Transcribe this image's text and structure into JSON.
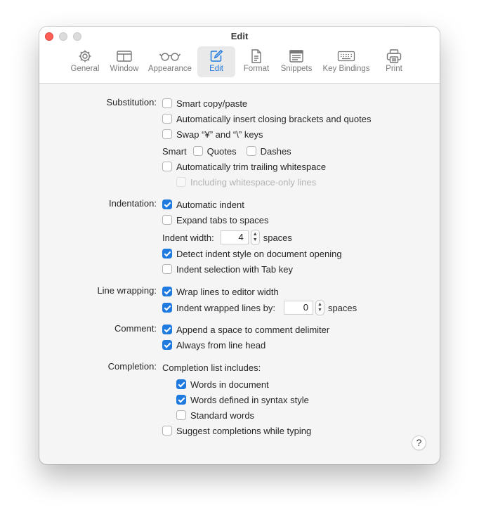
{
  "window": {
    "title": "Edit"
  },
  "toolbar": {
    "tabs": [
      {
        "label": "General",
        "icon": "gear-icon"
      },
      {
        "label": "Window",
        "icon": "window-layout-icon"
      },
      {
        "label": "Appearance",
        "icon": "glasses-icon"
      },
      {
        "label": "Edit",
        "icon": "pencil-square-icon",
        "selected": true
      },
      {
        "label": "Format",
        "icon": "document-icon"
      },
      {
        "label": "Snippets",
        "icon": "snippets-icon"
      },
      {
        "label": "Key Bindings",
        "icon": "keyboard-icon"
      },
      {
        "label": "Print",
        "icon": "printer-icon"
      }
    ]
  },
  "substitution": {
    "label": "Substitution:",
    "smart_copy_paste": {
      "label": "Smart copy/paste",
      "checked": false
    },
    "auto_closing": {
      "label": "Automatically insert closing brackets and quotes",
      "checked": false
    },
    "swap_keys": {
      "label": "Swap “¥” and “\\” keys",
      "checked": false
    },
    "smart_label": "Smart",
    "smart_quotes": {
      "label": "Quotes",
      "checked": false
    },
    "smart_dashes": {
      "label": "Dashes",
      "checked": false
    },
    "trim_whitespace": {
      "label": "Automatically trim trailing whitespace",
      "checked": false
    },
    "including_whitespace_only": {
      "label": "Including whitespace-only lines",
      "checked": false,
      "disabled": true
    }
  },
  "indentation": {
    "label": "Indentation:",
    "automatic_indent": {
      "label": "Automatic indent",
      "checked": true
    },
    "expand_tabs": {
      "label": "Expand tabs to spaces",
      "checked": false
    },
    "indent_width_label": "Indent width:",
    "indent_width_value": "4",
    "indent_width_unit": "spaces",
    "detect_indent_style": {
      "label": "Detect indent style on document opening",
      "checked": true
    },
    "indent_selection_tab": {
      "label": "Indent selection with Tab key",
      "checked": false
    }
  },
  "line_wrapping": {
    "label": "Line wrapping:",
    "wrap_lines": {
      "label": "Wrap lines to editor width",
      "checked": true
    },
    "indent_wrapped": {
      "label": "Indent wrapped lines by:",
      "checked": true
    },
    "indent_wrapped_value": "0",
    "indent_wrapped_unit": "spaces"
  },
  "comment": {
    "label": "Comment:",
    "append_space": {
      "label": "Append a space to comment delimiter",
      "checked": true
    },
    "from_line_head": {
      "label": "Always from line head",
      "checked": true
    }
  },
  "completion": {
    "label": "Completion:",
    "includes_label": "Completion list includes:",
    "words_in_document": {
      "label": "Words in document",
      "checked": true
    },
    "words_syntax_style": {
      "label": "Words defined in syntax style",
      "checked": true
    },
    "standard_words": {
      "label": "Standard words",
      "checked": false
    },
    "suggest_while_typing": {
      "label": "Suggest completions while typing",
      "checked": false
    }
  },
  "help": {
    "label": "?"
  },
  "stepper": {
    "up": "▲",
    "down": "▼"
  },
  "colors": {
    "accent": "#1f7ae0",
    "close": "#fe5f57"
  }
}
